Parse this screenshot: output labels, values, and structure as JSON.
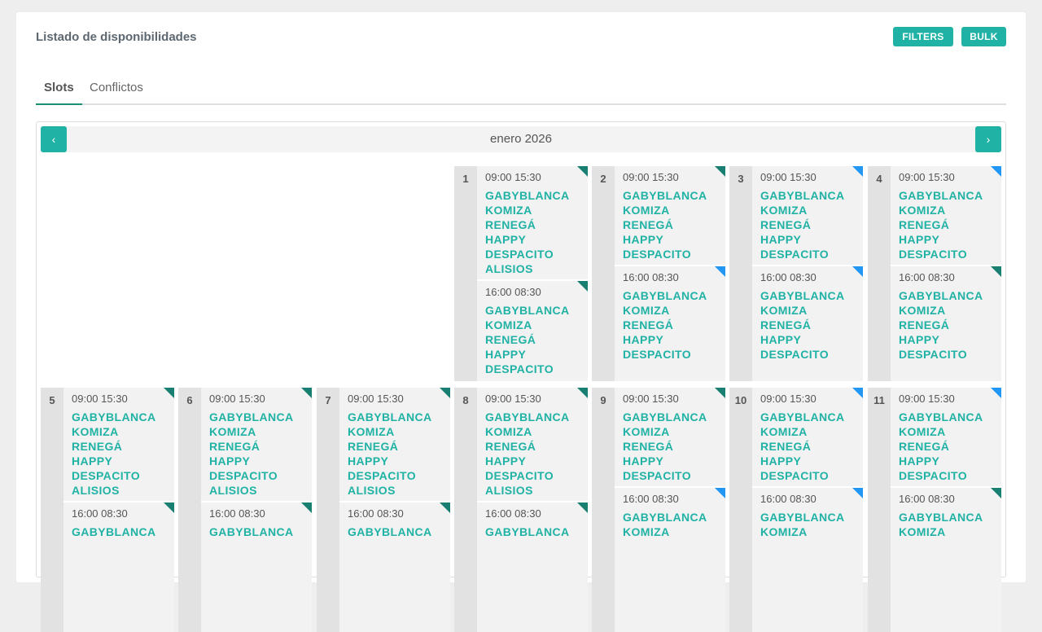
{
  "header": {
    "title": "Listado de disponibilidades",
    "filters_label": "FILTERS",
    "bulk_label": "BULK"
  },
  "tabs": [
    {
      "label": "Slots"
    },
    {
      "label": "Conflictos"
    }
  ],
  "calendar": {
    "month_label": "enero 2026",
    "prev_icon": "‹",
    "next_icon": "›",
    "days": [
      {
        "num": "1",
        "slots": [
          {
            "time": "09:00 15:30",
            "flag": "teal",
            "props": [
              "GABYBLANCA",
              "KOMIZA",
              "RENEGÁ",
              "HAPPY",
              "DESPACITO",
              "ALISIOS"
            ]
          },
          {
            "time": "16:00 08:30",
            "flag": "teal",
            "props": [
              "GABYBLANCA",
              "KOMIZA",
              "RENEGÁ",
              "HAPPY",
              "DESPACITO"
            ]
          }
        ]
      },
      {
        "num": "2",
        "slots": [
          {
            "time": "09:00 15:30",
            "flag": "teal",
            "props": [
              "GABYBLANCA",
              "KOMIZA",
              "RENEGÁ",
              "HAPPY",
              "DESPACITO"
            ]
          },
          {
            "time": "16:00 08:30",
            "flag": "blue",
            "props": [
              "GABYBLANCA",
              "KOMIZA",
              "RENEGÁ",
              "HAPPY",
              "DESPACITO"
            ]
          }
        ]
      },
      {
        "num": "3",
        "slots": [
          {
            "time": "09:00 15:30",
            "flag": "blue",
            "props": [
              "GABYBLANCA",
              "KOMIZA",
              "RENEGÁ",
              "HAPPY",
              "DESPACITO"
            ]
          },
          {
            "time": "16:00 08:30",
            "flag": "blue",
            "props": [
              "GABYBLANCA",
              "KOMIZA",
              "RENEGÁ",
              "HAPPY",
              "DESPACITO"
            ]
          }
        ]
      },
      {
        "num": "4",
        "slots": [
          {
            "time": "09:00 15:30",
            "flag": "blue",
            "props": [
              "GABYBLANCA",
              "KOMIZA",
              "RENEGÁ",
              "HAPPY",
              "DESPACITO"
            ]
          },
          {
            "time": "16:00 08:30",
            "flag": "teal",
            "props": [
              "GABYBLANCA",
              "KOMIZA",
              "RENEGÁ",
              "HAPPY",
              "DESPACITO"
            ]
          }
        ]
      },
      {
        "num": "5",
        "slots": [
          {
            "time": "09:00 15:30",
            "flag": "teal",
            "props": [
              "GABYBLANCA",
              "KOMIZA",
              "RENEGÁ",
              "HAPPY",
              "DESPACITO",
              "ALISIOS"
            ]
          },
          {
            "time": "16:00 08:30",
            "flag": "teal",
            "props": [
              "GABYBLANCA"
            ]
          }
        ]
      },
      {
        "num": "6",
        "slots": [
          {
            "time": "09:00 15:30",
            "flag": "teal",
            "props": [
              "GABYBLANCA",
              "KOMIZA",
              "RENEGÁ",
              "HAPPY",
              "DESPACITO",
              "ALISIOS"
            ]
          },
          {
            "time": "16:00 08:30",
            "flag": "teal",
            "props": [
              "GABYBLANCA"
            ]
          }
        ]
      },
      {
        "num": "7",
        "slots": [
          {
            "time": "09:00 15:30",
            "flag": "teal",
            "props": [
              "GABYBLANCA",
              "KOMIZA",
              "RENEGÁ",
              "HAPPY",
              "DESPACITO",
              "ALISIOS"
            ]
          },
          {
            "time": "16:00 08:30",
            "flag": "teal",
            "props": [
              "GABYBLANCA"
            ]
          }
        ]
      },
      {
        "num": "8",
        "slots": [
          {
            "time": "09:00 15:30",
            "flag": "teal",
            "props": [
              "GABYBLANCA",
              "KOMIZA",
              "RENEGÁ",
              "HAPPY",
              "DESPACITO",
              "ALISIOS"
            ]
          },
          {
            "time": "16:00 08:30",
            "flag": "teal",
            "props": [
              "GABYBLANCA"
            ]
          }
        ]
      },
      {
        "num": "9",
        "slots": [
          {
            "time": "09:00 15:30",
            "flag": "teal",
            "props": [
              "GABYBLANCA",
              "KOMIZA",
              "RENEGÁ",
              "HAPPY",
              "DESPACITO"
            ]
          },
          {
            "time": "16:00 08:30",
            "flag": "blue",
            "props": [
              "GABYBLANCA",
              "KOMIZA"
            ]
          }
        ]
      },
      {
        "num": "10",
        "slots": [
          {
            "time": "09:00 15:30",
            "flag": "blue",
            "props": [
              "GABYBLANCA",
              "KOMIZA",
              "RENEGÁ",
              "HAPPY",
              "DESPACITO"
            ]
          },
          {
            "time": "16:00 08:30",
            "flag": "blue",
            "props": [
              "GABYBLANCA",
              "KOMIZA"
            ]
          }
        ]
      },
      {
        "num": "11",
        "slots": [
          {
            "time": "09:00 15:30",
            "flag": "blue",
            "props": [
              "GABYBLANCA",
              "KOMIZA",
              "RENEGÁ",
              "HAPPY",
              "DESPACITO"
            ]
          },
          {
            "time": "16:00 08:30",
            "flag": "teal",
            "props": [
              "GABYBLANCA",
              "KOMIZA"
            ]
          }
        ]
      }
    ]
  },
  "colors": {
    "accent": "#20b2a5",
    "flag_teal": "#1a7f73",
    "flag_blue": "#2196f3"
  }
}
